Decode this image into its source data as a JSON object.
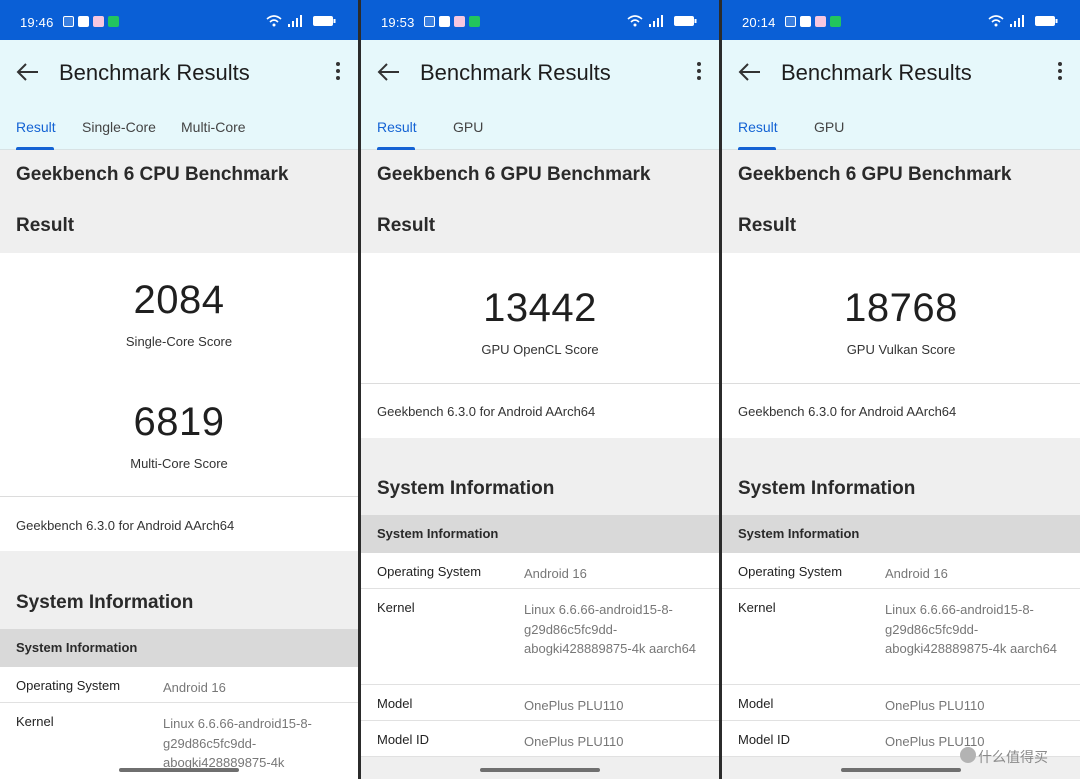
{
  "colors": {
    "status_bar": "#0a5fd6",
    "app_bar": "#e6f8fb",
    "accent": "#1463d4",
    "section_bg": "#efefef",
    "table_header": "#d9d9d9"
  },
  "icons": {
    "back": "arrow-left-icon",
    "menu": "more-vert-icon",
    "wifi": "wifi-icon",
    "signal": "cell-signal-icon",
    "battery": "battery-icon"
  },
  "screens": [
    {
      "time": "19:46",
      "title": "Benchmark Results",
      "tabs": [
        {
          "label": "Result",
          "active": true
        },
        {
          "label": "Single-Core"
        },
        {
          "label": "Multi-Core"
        }
      ],
      "heading": "Geekbench 6 CPU Benchmark",
      "result_heading": "Result",
      "scores": [
        {
          "value": "2084",
          "label": "Single-Core Score"
        },
        {
          "value": "6819",
          "label": "Multi-Core Score"
        }
      ],
      "version": "Geekbench 6.3.0 for Android AArch64",
      "sysinfo_title": "System Information",
      "table_header": "System Information",
      "rows": [
        {
          "key": "Operating System",
          "value": "Android 16"
        },
        {
          "key": "Kernel",
          "value": "Linux 6.6.66-android15-8-g29d86c5fc9dd-abogki428889875-4k"
        }
      ]
    },
    {
      "time": "19:53",
      "title": "Benchmark Results",
      "tabs": [
        {
          "label": "Result",
          "active": true
        },
        {
          "label": "GPU"
        }
      ],
      "heading": "Geekbench 6 GPU Benchmark",
      "result_heading": "Result",
      "scores": [
        {
          "value": "13442",
          "label": "GPU OpenCL Score"
        }
      ],
      "version": "Geekbench 6.3.0 for Android AArch64",
      "sysinfo_title": "System Information",
      "table_header": "System Information",
      "rows": [
        {
          "key": "Operating System",
          "value": "Android 16"
        },
        {
          "key": "Kernel",
          "value": "Linux 6.6.66-android15-8-g29d86c5fc9dd-abogki428889875-4k aarch64"
        },
        {
          "key": "Model",
          "value": "OnePlus PLU110"
        },
        {
          "key": "Model ID",
          "value": "OnePlus PLU110"
        }
      ]
    },
    {
      "time": "20:14",
      "title": "Benchmark Results",
      "tabs": [
        {
          "label": "Result",
          "active": true
        },
        {
          "label": "GPU"
        }
      ],
      "heading": "Geekbench 6 GPU Benchmark",
      "result_heading": "Result",
      "scores": [
        {
          "value": "18768",
          "label": "GPU Vulkan Score"
        }
      ],
      "version": "Geekbench 6.3.0 for Android AArch64",
      "sysinfo_title": "System Information",
      "table_header": "System Information",
      "rows": [
        {
          "key": "Operating System",
          "value": "Android 16"
        },
        {
          "key": "Kernel",
          "value": "Linux 6.6.66-android15-8-g29d86c5fc9dd-abogki428889875-4k aarch64"
        },
        {
          "key": "Model",
          "value": "OnePlus PLU110"
        },
        {
          "key": "Model ID",
          "value": "OnePlus PLU110"
        }
      ]
    }
  ],
  "watermark": {
    "text": "什么值得买",
    "icon": "smzdm-logo-icon"
  }
}
